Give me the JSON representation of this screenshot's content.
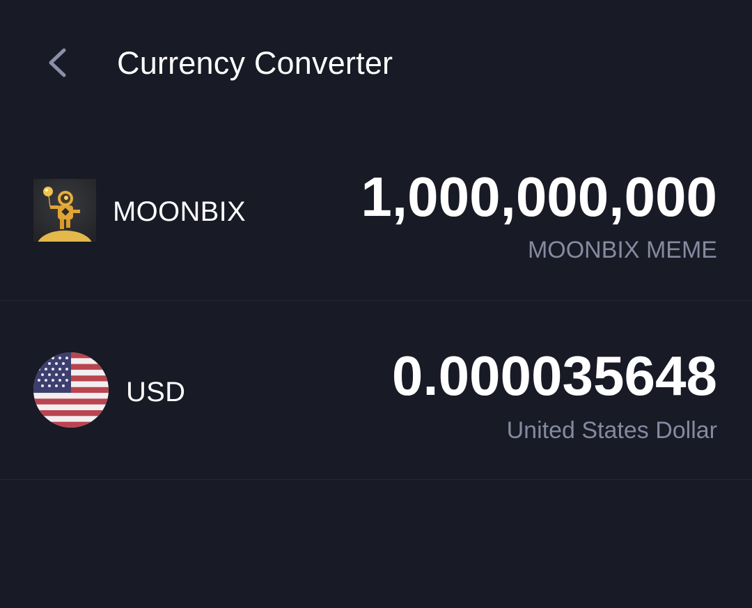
{
  "header": {
    "title": "Currency Converter",
    "back_icon": "chevron-left-icon"
  },
  "rows": [
    {
      "code": "MOONBIX",
      "amount": "1,000,000,000",
      "name": "MOONBIX MEME",
      "icon": "moonbix-token-icon"
    },
    {
      "code": "USD",
      "amount": "0.000035648",
      "name": "United States Dollar",
      "icon": "us-flag-icon"
    }
  ],
  "colors": {
    "background": "#181a25",
    "primary_text": "#ffffff",
    "secondary_text": "#858aa0",
    "divider": "#262936",
    "back_icon": "#8b90a8"
  }
}
